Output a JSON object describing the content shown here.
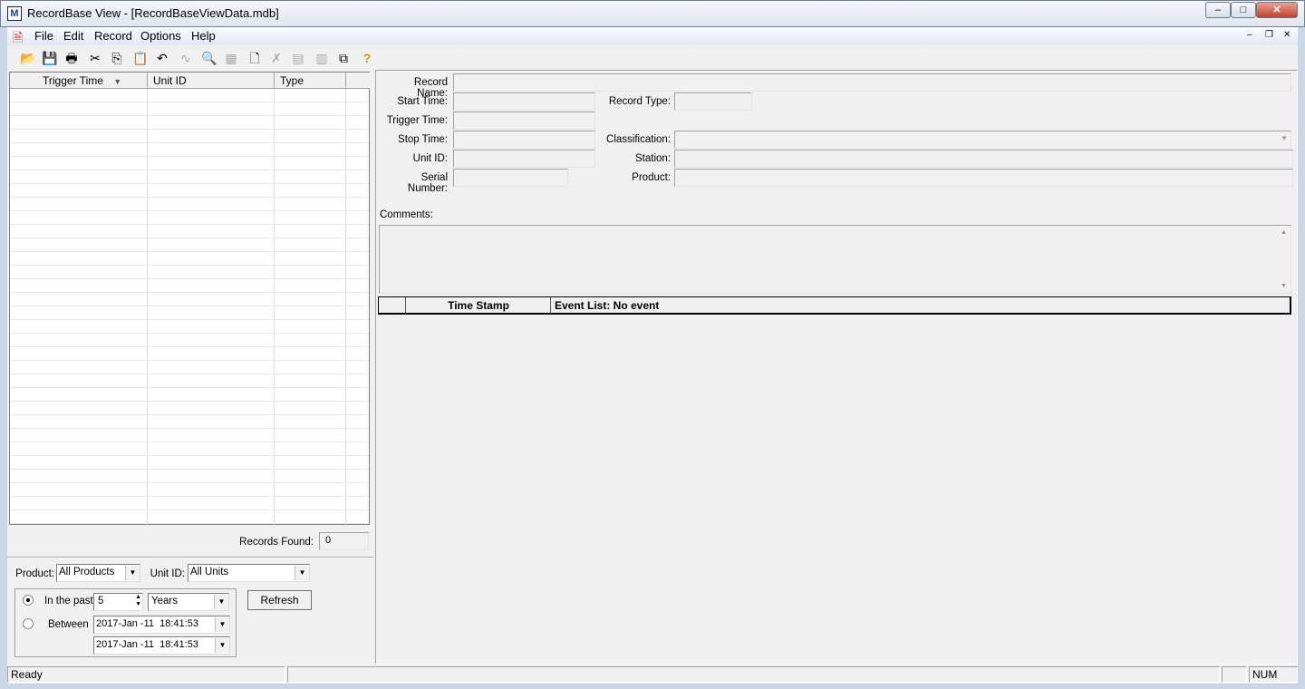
{
  "window": {
    "title": "RecordBase View - [RecordBaseViewData.mdb]",
    "minimize": "–",
    "maximize": "□",
    "close": "✕"
  },
  "menu": {
    "items": [
      "File",
      "Edit",
      "Record",
      "Options",
      "Help"
    ]
  },
  "mdi": {
    "minimize": "–",
    "restore": "❐",
    "close": "✕"
  },
  "toolbar": [
    {
      "name": "open-icon",
      "glyph": "📂",
      "enabled": true
    },
    {
      "name": "save-icon",
      "glyph": "💾",
      "enabled": true
    },
    {
      "name": "print-icon",
      "glyph": "🖶",
      "enabled": true
    },
    {
      "name": "cut-icon",
      "glyph": "✂",
      "enabled": true
    },
    {
      "name": "copy-icon",
      "glyph": "⎘",
      "enabled": true
    },
    {
      "name": "paste-icon",
      "glyph": "📋",
      "enabled": true
    },
    {
      "name": "undo-icon",
      "glyph": "↶",
      "enabled": true
    },
    {
      "name": "waveform-icon",
      "glyph": "∿",
      "enabled": false
    },
    {
      "name": "inspect-record-icon",
      "glyph": "🔍",
      "enabled": false
    },
    {
      "name": "export-record-icon",
      "glyph": "▦",
      "enabled": false
    },
    {
      "name": "new-record-icon",
      "glyph": "🗋",
      "enabled": true
    },
    {
      "name": "delete-record-icon",
      "glyph": "✗",
      "enabled": false
    },
    {
      "name": "properties-icon",
      "glyph": "▤",
      "enabled": false
    },
    {
      "name": "chart-icon",
      "glyph": "▥",
      "enabled": false
    },
    {
      "name": "import-icon",
      "glyph": "⧉",
      "enabled": true
    },
    {
      "name": "help-icon",
      "glyph": "?",
      "enabled": true
    }
  ],
  "list": {
    "columns": [
      "Trigger Time",
      "Unit ID",
      "Type"
    ],
    "sort_icon": "▼",
    "records_found_label": "Records Found:",
    "records_found": "0"
  },
  "filter": {
    "product_label": "Product:",
    "product_value": "All Products",
    "unit_label": "Unit ID:",
    "unit_value": "All Units",
    "in_past_label": "In the past",
    "in_past_value": "5",
    "in_past_unit": "Years",
    "in_past_selected": true,
    "between_label": "Between",
    "between_start": "2017-Jan -11  18:41:53",
    "between_end": "2017-Jan -11  18:41:53",
    "refresh": "Refresh"
  },
  "form": {
    "record_name": "Record Name:",
    "start_time": "Start Time:",
    "trigger_time": "Trigger Time:",
    "stop_time": "Stop Time:",
    "unit_id": "Unit ID:",
    "serial_number": "Serial Number:",
    "record_type": "Record Type:",
    "classification": "Classification:",
    "station": "Station:",
    "product": "Product:",
    "comments": "Comments:"
  },
  "events": {
    "col_time": "Time Stamp",
    "col_list": "Event List: No event"
  },
  "status": {
    "text": "Ready",
    "num": "NUM"
  }
}
